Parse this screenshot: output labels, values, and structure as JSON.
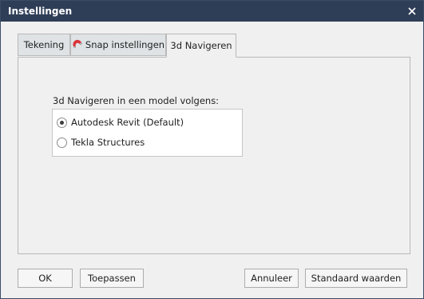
{
  "window": {
    "title": "Instellingen"
  },
  "tabs": [
    {
      "label": "Tekening"
    },
    {
      "label": "Snap instellingen",
      "icon": "magnet-icon"
    },
    {
      "label": "3d Navigeren"
    }
  ],
  "active_tab": "3d Navigeren",
  "navigation": {
    "group_label": "3d Navigeren in een model volgens:",
    "options": [
      {
        "label": "Autodesk Revit (Default)",
        "selected": true
      },
      {
        "label": "Tekla Structures",
        "selected": false
      }
    ]
  },
  "buttons": {
    "ok": "OK",
    "apply": "Toepassen",
    "cancel": "Annuleer",
    "defaults": "Standaard waarden"
  },
  "colors": {
    "titlebar": "#2f3e57",
    "magnet_red": "#d9343b"
  }
}
